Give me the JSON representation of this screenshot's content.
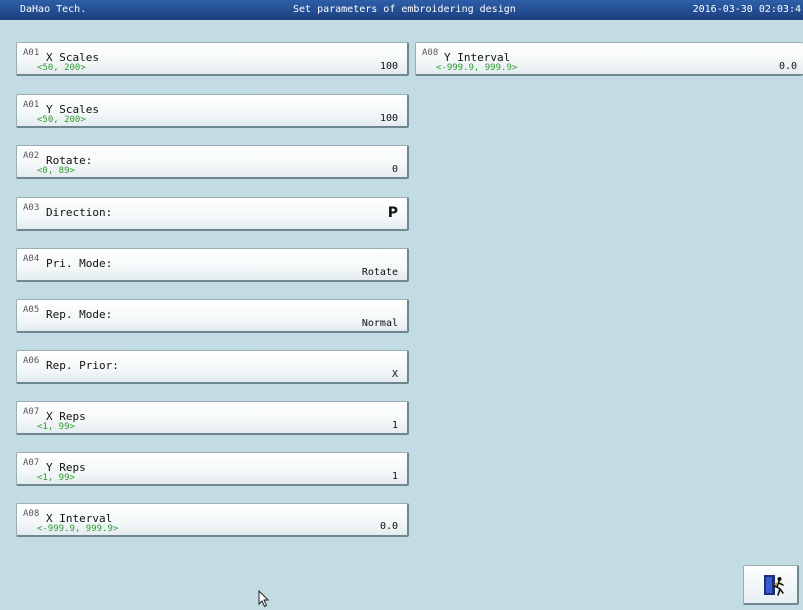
{
  "titlebar": {
    "left": "DaHao Tech.",
    "center": "Set parameters of embroidering design",
    "right": "2016-03-30 02:03:4"
  },
  "params": [
    {
      "code": "A01",
      "name": "X Scales",
      "range": "<50, 200>",
      "value": "100"
    },
    {
      "code": "A01",
      "name": "Y Scales",
      "range": "<50, 200>",
      "value": "100"
    },
    {
      "code": "A02",
      "name": "Rotate:",
      "range": "<0, 89>",
      "value": "0"
    },
    {
      "code": "A03",
      "name": "Direction:",
      "value": "P"
    },
    {
      "code": "A04",
      "name": "Pri. Mode:",
      "value": "Rotate"
    },
    {
      "code": "A05",
      "name": "Rep. Mode:",
      "value": "Normal"
    },
    {
      "code": "A06",
      "name": "Rep. Prior:",
      "value": "X"
    },
    {
      "code": "A07",
      "name": "X Reps",
      "range": "<1, 99>",
      "value": "1"
    },
    {
      "code": "A07",
      "name": "Y Reps",
      "range": "<1, 99>",
      "value": "1"
    },
    {
      "code": "A08",
      "name": "X Interval",
      "range": "<-999.9, 999.9>",
      "value": "0.0"
    },
    {
      "code": "A08",
      "name": "Y Interval",
      "range": "<-999.9, 999.9>",
      "value": "0.0"
    }
  ],
  "exit_button": {
    "icon": "exit-door-icon"
  },
  "colors": {
    "titlebar": "#1c3f80",
    "background": "#c3dce4",
    "range_text": "#2e9a2e"
  }
}
